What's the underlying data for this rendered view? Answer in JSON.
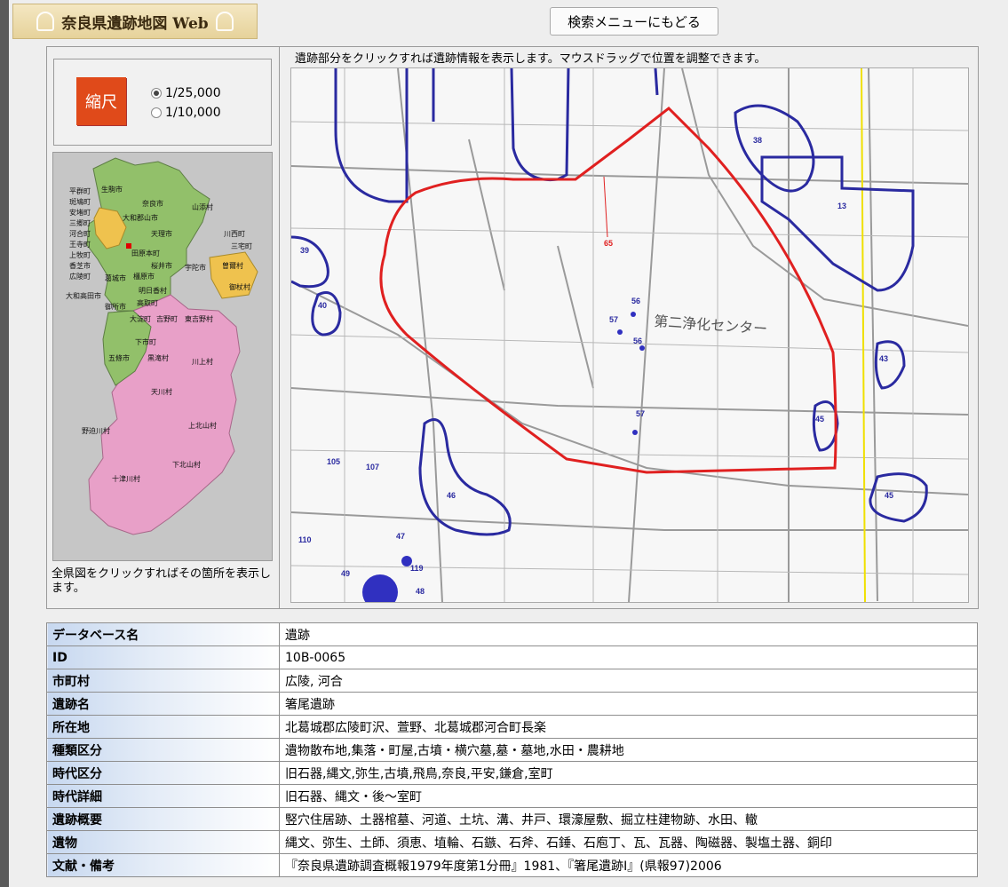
{
  "app": {
    "title": "奈良県遺跡地図 Web",
    "back_button": "検索メニューにもどる"
  },
  "scale": {
    "icon_label": "縮尺",
    "options": [
      "1/25,000",
      "1/10,000"
    ],
    "selected": "1/25,000"
  },
  "prefecture_map": {
    "caption": "全県図をクリックすればその箇所を表示します。",
    "municipalities": [
      "平群町",
      "生駒市",
      "奈良市",
      "斑鳩町",
      "安堵町",
      "大和郡山市",
      "山添村",
      "三郷町",
      "河合町",
      "天理市",
      "川西町",
      "王寺町",
      "上牧町",
      "田原本町",
      "三宅町",
      "香芝市",
      "桜井市",
      "宇陀市",
      "曽爾村",
      "広陵町",
      "葛城市",
      "橿原市",
      "御杖村",
      "明日香村",
      "大和高田市",
      "御所市",
      "高取町",
      "大淀町",
      "吉野町",
      "東吉野村",
      "下市町",
      "五條市",
      "黒滝村",
      "川上村",
      "天川村",
      "野迫川村",
      "上北山村",
      "下北山村",
      "十津川村"
    ]
  },
  "map": {
    "instruction": "遺跡部分をクリックすれば遺跡情報を表示します。マウスドラッグで位置を調整できます。",
    "site_labels": [
      "38",
      "13",
      "39",
      "40",
      "65",
      "56",
      "57",
      "56",
      "43",
      "45",
      "57",
      "45",
      "46",
      "105",
      "107",
      "110",
      "47",
      "119",
      "49",
      "48"
    ],
    "building_label": "第二浄化センター",
    "colors": {
      "selected_site": "#e02020",
      "other_sites": "#2a2aa0",
      "boundary_line": "#f0e000"
    }
  },
  "details": {
    "rows": [
      {
        "label": "データベース名",
        "value": "遺跡"
      },
      {
        "label": "ID",
        "value": "10B-0065"
      },
      {
        "label": "市町村",
        "value": "広陵, 河合"
      },
      {
        "label": "遺跡名",
        "value": "箸尾遺跡"
      },
      {
        "label": "所在地",
        "value": "北葛城郡広陵町沢、萱野、北葛城郡河合町長楽"
      },
      {
        "label": "種類区分",
        "value": "遺物散布地,集落・町屋,古墳・横穴墓,墓・墓地,水田・農耕地"
      },
      {
        "label": "時代区分",
        "value": "旧石器,縄文,弥生,古墳,飛鳥,奈良,平安,鎌倉,室町"
      },
      {
        "label": "時代詳細",
        "value": "旧石器、縄文・後～室町"
      },
      {
        "label": "遺跡概要",
        "value": "竪穴住居跡、土器棺墓、河道、土坑、溝、井戸、環濠屋敷、掘立柱建物跡、水田、轍"
      },
      {
        "label": "遺物",
        "value": "縄文、弥生、土師、須恵、埴輪、石鏃、石斧、石錘、石庖丁、瓦、瓦器、陶磁器、製塩土器、銅印"
      },
      {
        "label": "文献・備考",
        "value": "『奈良県遺跡調査概報1979年度第1分冊』1981、『箸尾遺跡I』(県報97)2006"
      }
    ]
  }
}
